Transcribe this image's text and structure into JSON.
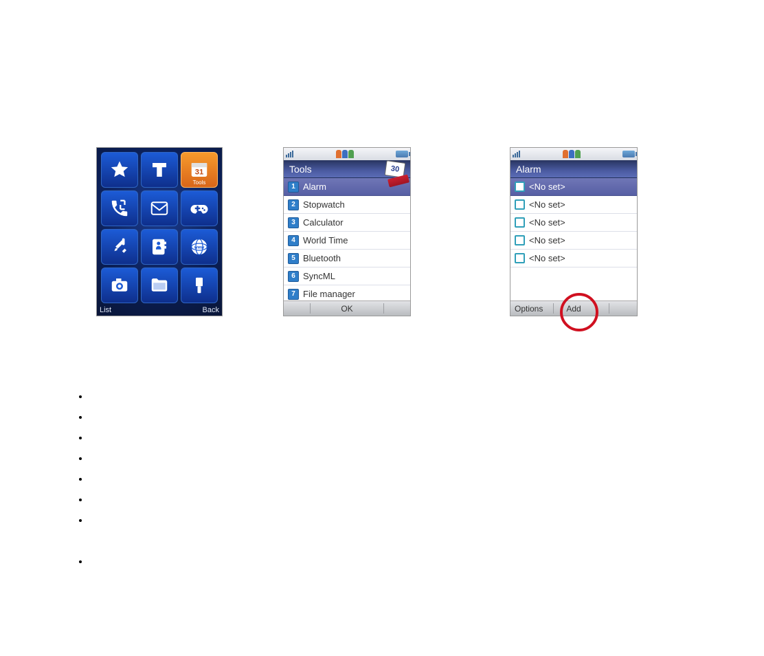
{
  "phone1": {
    "softkey_left": "List",
    "softkey_right": "Back",
    "selected_caption": "Tools",
    "selected_day": "31",
    "icons": [
      {
        "name": "favorites-star-icon"
      },
      {
        "name": "carrier-t-icon"
      },
      {
        "name": "calendar-tools-icon",
        "selected": true
      },
      {
        "name": "call-log-icon"
      },
      {
        "name": "messaging-envelope-icon"
      },
      {
        "name": "games-controller-icon"
      },
      {
        "name": "settings-tools-icon"
      },
      {
        "name": "contacts-phonebook-icon"
      },
      {
        "name": "browser-www-icon"
      },
      {
        "name": "camera-icon"
      },
      {
        "name": "file-manager-folder-icon"
      },
      {
        "name": "themes-brush-icon"
      }
    ]
  },
  "phone2": {
    "title": "Tools",
    "calendar_badge_day": "30",
    "softkey_center": "OK",
    "items": [
      {
        "num": "1",
        "label": "Alarm",
        "selected": true
      },
      {
        "num": "2",
        "label": "Stopwatch"
      },
      {
        "num": "3",
        "label": "Calculator"
      },
      {
        "num": "4",
        "label": "World Time"
      },
      {
        "num": "5",
        "label": "Bluetooth"
      },
      {
        "num": "6",
        "label": "SyncML"
      },
      {
        "num": "7",
        "label": "File manager"
      }
    ]
  },
  "phone3": {
    "title": "Alarm",
    "softkey_left": "Options",
    "softkey_center": "Add",
    "items": [
      {
        "label": "<No set>",
        "selected": true
      },
      {
        "label": "<No set>"
      },
      {
        "label": "<No set>"
      },
      {
        "label": "<No set>"
      },
      {
        "label": "<No set>"
      }
    ]
  },
  "bullets": [
    "",
    "",
    "",
    "",
    "",
    "",
    "",
    "",
    ""
  ]
}
